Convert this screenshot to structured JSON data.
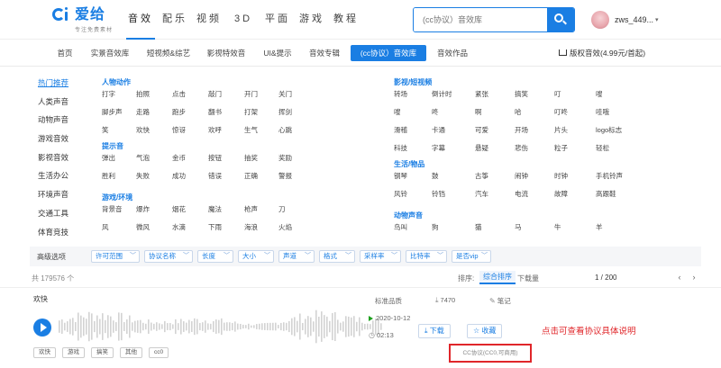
{
  "header": {
    "logo_name": "爱给",
    "logo_sub": "专注免费素材",
    "nav": [
      "音效",
      "配乐",
      "视频",
      "3D",
      "平面",
      "游戏",
      "教程"
    ],
    "search_placeholder": "(cc协议）音效库",
    "username": "zws_449..."
  },
  "subnav": {
    "tabs": [
      "首页",
      "实景音效库",
      "短视频&综艺",
      "影视特效音",
      "UI&提示",
      "音效专辑",
      "(cc协议）音效库",
      "音效作品"
    ],
    "cart": "版权音效(4.99元/首起)"
  },
  "categories": {
    "side": [
      "热门推荐",
      "人类声音",
      "动物声音",
      "游戏音效",
      "影视音效",
      "生活办公",
      "环境声音",
      "交通工具",
      "体育竞技"
    ],
    "groups": [
      {
        "title": "人物动作",
        "tags": [
          "打字",
          "拍照",
          "点击",
          "敲门",
          "开门",
          "关门",
          "脚步声",
          "走路",
          "跑步",
          "翻书",
          "打架",
          "挥剑",
          "笑",
          "欢快",
          "惊讶",
          "欢呼",
          "生气",
          "心跳"
        ]
      },
      {
        "title": "提示音",
        "tags": [
          "弹出",
          "气泡",
          "金币",
          "按钮",
          "抽奖",
          "奖励",
          "胜利",
          "失败",
          "成功",
          "错误",
          "正确",
          "警报"
        ]
      },
      {
        "title": "游戏/环境",
        "tags": [
          "背景音",
          "爆炸",
          "烟花",
          "魔法",
          "枪声",
          "刀",
          "风",
          "微风",
          "水滴",
          "下雨",
          "海浪",
          "火焰"
        ]
      },
      {
        "title": "影视/短视频",
        "tags": [
          "转场",
          "倒计时",
          "紧张",
          "搞笑",
          "叮",
          "嗖",
          "嗖",
          "咚",
          "啊",
          "哈",
          "叮咚",
          "哇哦",
          "滑稽",
          "卡通",
          "可爱",
          "开场",
          "片头",
          "logo标志",
          "科技",
          "字幕",
          "悬疑",
          "悲伤",
          "粒子",
          "轻松"
        ]
      },
      {
        "title": "生活/物品",
        "tags": [
          "钢琴",
          "鼓",
          "古筝",
          "闹钟",
          "时钟",
          "手机铃声",
          "风铃",
          "铃铛",
          "汽车",
          "电流",
          "故障",
          "高跟鞋"
        ]
      },
      {
        "title": "动物声音",
        "tags": [
          "鸟叫",
          "狗",
          "猫",
          "马",
          "牛",
          "羊"
        ]
      }
    ]
  },
  "filters": {
    "label": "高级选项",
    "options": [
      "许可范围",
      "协议名称",
      "长度",
      "大小",
      "声道",
      "格式",
      "采样率",
      "比特率",
      "是否vip"
    ]
  },
  "results": {
    "count": "共 179576 个",
    "sort_label": "排序:",
    "sort_active": "综合排序",
    "sort_other": "下载量",
    "pager": "1 / 200",
    "prev": "‹",
    "next": "›"
  },
  "sound": {
    "title": "欢快",
    "keywords": [
      "欢快",
      "游戏",
      "搞笑",
      "其他",
      "cc0"
    ],
    "quality": "标准品质",
    "downloads": "7470",
    "notes": "笔记",
    "date": "2020-10-12",
    "duration": "02:13",
    "download_label": "下载",
    "fav_label": "收藏",
    "license": "CC协议(CC0,可商用)",
    "annotation": "点击可查看协议具体说明"
  },
  "colors": {
    "accent": "#1a7ee3",
    "highlight": "#e0262a"
  }
}
